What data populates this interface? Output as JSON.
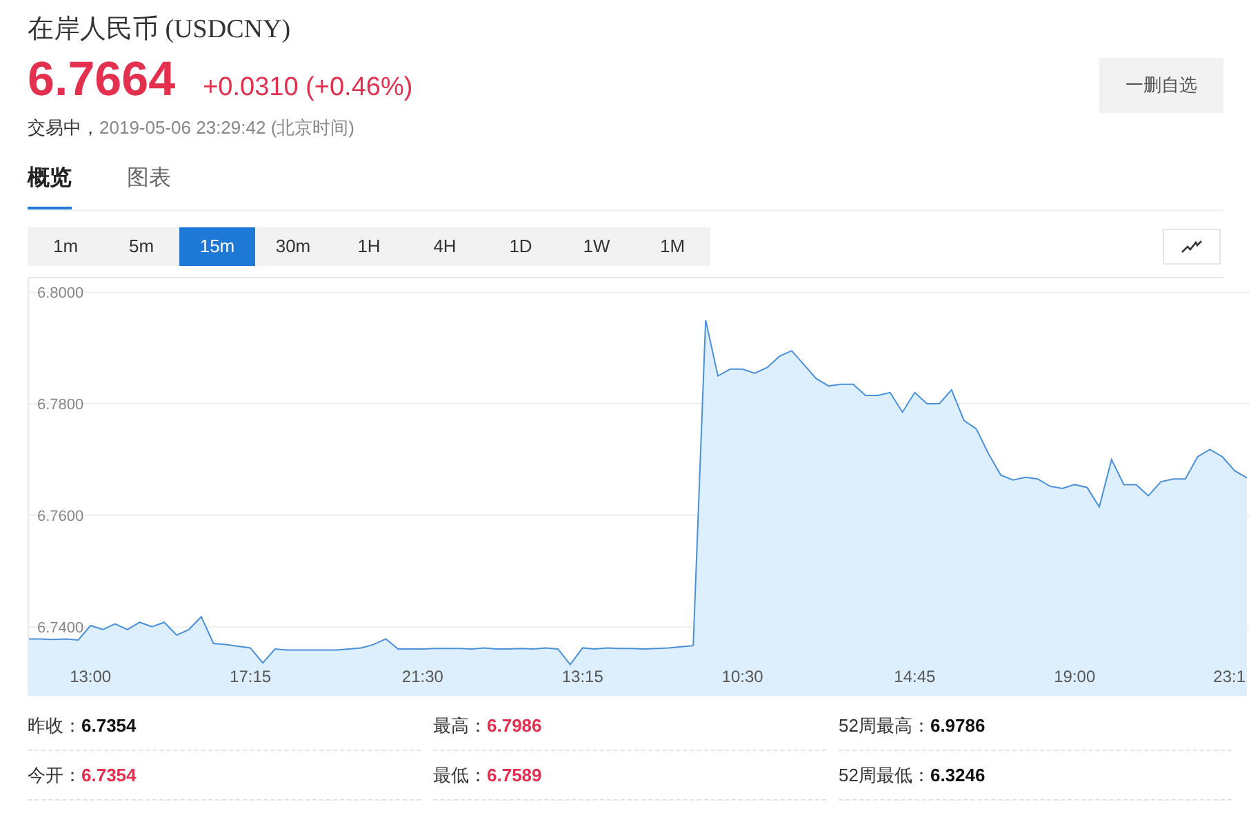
{
  "header": {
    "title": "在岸人民币 (USDCNY)",
    "price": "6.7664",
    "change": "+0.0310 (+0.46%)",
    "status": "交易中，",
    "timestamp": "2019-05-06 23:29:42 (北京时间)",
    "watch_button": "一删自选"
  },
  "tabs": [
    {
      "label": "概览",
      "selected": true
    },
    {
      "label": "图表",
      "selected": false
    }
  ],
  "periods": [
    {
      "label": "1m",
      "selected": false
    },
    {
      "label": "5m",
      "selected": false
    },
    {
      "label": "15m",
      "selected": true
    },
    {
      "label": "30m",
      "selected": false
    },
    {
      "label": "1H",
      "selected": false
    },
    {
      "label": "4H",
      "selected": false
    },
    {
      "label": "1D",
      "selected": false
    },
    {
      "label": "1W",
      "selected": false
    },
    {
      "label": "1M",
      "selected": false
    }
  ],
  "chart": {
    "chart_data": {
      "type": "area",
      "categories": [
        null,
        null,
        null,
        null,
        null,
        "13:00",
        null,
        null,
        null,
        null,
        null,
        null,
        null,
        null,
        null,
        null,
        null,
        null,
        "17:15",
        null,
        null,
        null,
        null,
        null,
        null,
        null,
        null,
        null,
        null,
        null,
        null,
        null,
        "21:30",
        null,
        null,
        null,
        null,
        null,
        null,
        null,
        null,
        null,
        null,
        null,
        null,
        "13:15",
        null,
        null,
        null,
        null,
        null,
        null,
        null,
        null,
        null,
        null,
        null,
        null,
        "10:30",
        null,
        null,
        null,
        null,
        null,
        null,
        null,
        null,
        null,
        null,
        null,
        null,
        null,
        "14:45",
        null,
        null,
        null,
        null,
        null,
        null,
        null,
        null,
        null,
        null,
        null,
        null,
        "19:00",
        null,
        null,
        null,
        null,
        null,
        null,
        null,
        null,
        null,
        null,
        null,
        null,
        "23:1",
        null
      ],
      "series": [
        {
          "color": "#4a90d9",
          "values": [
            6.7378,
            6.7378,
            6.7377,
            6.7378,
            6.7376,
            6.7402,
            6.7395,
            6.7405,
            6.7395,
            6.7408,
            6.74,
            6.7408,
            6.7385,
            6.7395,
            6.7418,
            6.737,
            6.7368,
            6.7365,
            6.7362,
            6.7335,
            6.736,
            6.7358,
            6.7358,
            6.7358,
            6.7358,
            6.7358,
            6.736,
            6.7362,
            6.7368,
            6.7378,
            6.736,
            6.736,
            6.736,
            6.7361,
            6.7361,
            6.7361,
            6.736,
            6.7362,
            6.736,
            6.736,
            6.7361,
            6.736,
            6.7362,
            6.736,
            6.7332,
            6.7362,
            6.736,
            6.7362,
            6.7361,
            6.7361,
            6.736,
            6.7361,
            6.7362,
            6.7364,
            6.7366,
            6.795,
            6.785,
            6.7862,
            6.7862,
            6.7855,
            6.7865,
            6.7885,
            6.7895,
            6.787,
            6.7845,
            6.7832,
            6.7835,
            6.7835,
            6.7815,
            6.7815,
            6.782,
            6.7785,
            6.782,
            6.78,
            6.78,
            6.7825,
            6.777,
            6.7755,
            6.771,
            6.7672,
            6.7663,
            6.7668,
            6.7665,
            6.7652,
            6.7648,
            6.7655,
            6.765,
            6.7615,
            6.77,
            6.7655,
            6.7655,
            6.7635,
            6.766,
            6.7665,
            6.7665,
            6.7705,
            6.7718,
            6.7705,
            6.768,
            6.7667
          ]
        }
      ],
      "grid": true,
      "ylim": [
        6.7276,
        6.8025
      ],
      "yticks": [
        {
          "value": 6.74,
          "label": "6.7400"
        },
        {
          "value": 6.76,
          "label": "6.7600"
        },
        {
          "value": 6.78,
          "label": "6.7800"
        },
        {
          "value": 6.8,
          "label": "6.8000"
        }
      ]
    }
  },
  "stats": [
    {
      "label": "昨收：",
      "value": "6.7354",
      "color": "#111111"
    },
    {
      "label": "最高：",
      "value": "6.7986",
      "color": "#e3304f"
    },
    {
      "label": "52周最高：",
      "value": "6.9786",
      "color": "#111111"
    },
    {
      "label": "今开：",
      "value": "6.7354",
      "color": "#e3304f"
    },
    {
      "label": "最低：",
      "value": "6.7589",
      "color": "#e3304f"
    },
    {
      "label": "52周最低：",
      "value": "6.3246",
      "color": "#111111"
    }
  ]
}
